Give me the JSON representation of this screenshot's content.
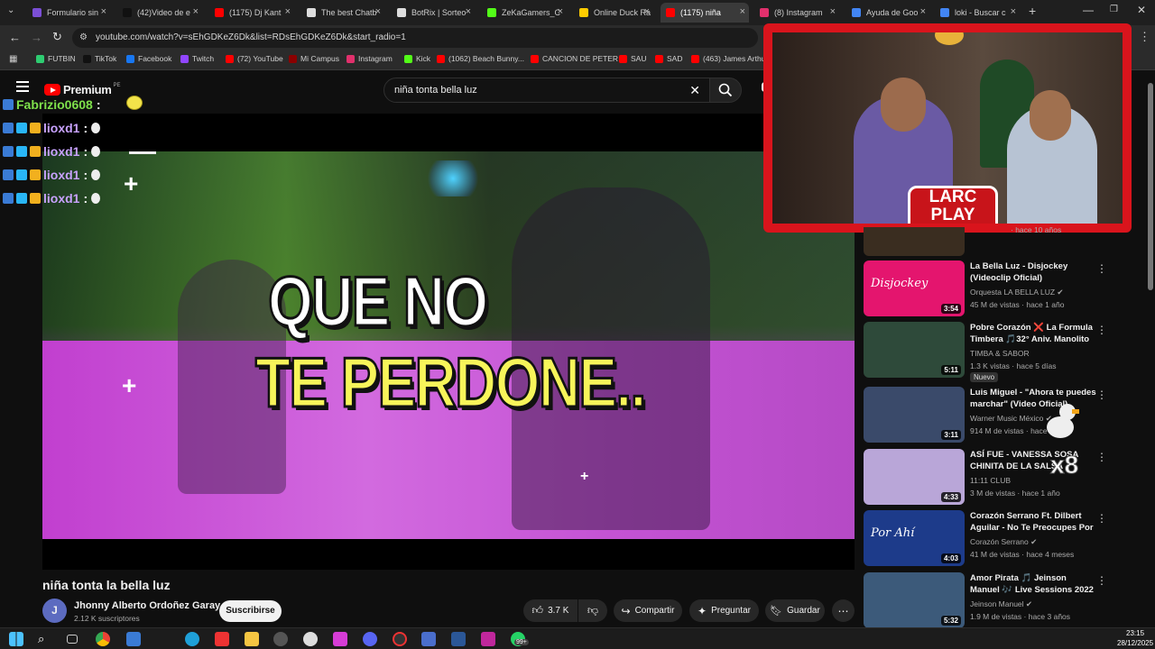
{
  "tabs": [
    {
      "label": "Formulario sin",
      "color": "#7b4fd6"
    },
    {
      "label": "(42)Video de e",
      "color": "#111111"
    },
    {
      "label": "(1175) Dj Kant",
      "color": "#ff0000"
    },
    {
      "label": "The best Chatb",
      "color": "#dddddd"
    },
    {
      "label": "BotRix | Sorteo",
      "color": "#dddddd"
    },
    {
      "label": "ZeKaGamers_C",
      "color": "#53fc18"
    },
    {
      "label": "Online Duck Ra",
      "color": "#ffcc00"
    },
    {
      "label": "(1175) niña",
      "color": "#ff0000"
    },
    {
      "label": "(8) Instagram",
      "color": "#e1306c"
    },
    {
      "label": "Ayuda de Goo",
      "color": "#4285f4"
    },
    {
      "label": "loki - Buscar c",
      "color": "#4285f4"
    }
  ],
  "url": "youtube.com/watch?v=sEhGDKeZ6Dk&list=RDsEhGDKeZ6Dk&start_radio=1",
  "bookmarks": [
    {
      "label": "FUTBIN",
      "color": "#2ecc71"
    },
    {
      "label": "TikTok",
      "color": "#111111"
    },
    {
      "label": "Facebook",
      "color": "#1877f2"
    },
    {
      "label": "Twitch",
      "color": "#9146ff"
    },
    {
      "label": "(72) YouTube",
      "color": "#ff0000"
    },
    {
      "label": "Mi Campus",
      "color": "#8b0000"
    },
    {
      "label": "Instagram",
      "color": "#e1306c"
    },
    {
      "label": "Kick",
      "color": "#53fc18"
    },
    {
      "label": "(1062) Beach Bunny...",
      "color": "#ff0000"
    },
    {
      "label": "CANCION DE PETER",
      "color": "#ff0000"
    },
    {
      "label": "SAU",
      "color": "#ff0000"
    },
    {
      "label": "SAD",
      "color": "#ff0000"
    },
    {
      "label": "(463) James Arthur...",
      "color": "#ff0000"
    }
  ],
  "bookmarks_more": "dores",
  "yt": {
    "logo_text": "Premium",
    "region": "PE",
    "search_value": "niña tonta bella luz"
  },
  "chat": [
    {
      "user": "Fabrizio0608",
      "sep": ":",
      "color": "#7ee04b"
    },
    {
      "user": "lioxd1",
      "sep": ":",
      "color": "#c8a2ff"
    },
    {
      "user": "lioxd1",
      "sep": ":",
      "color": "#c8a2ff"
    },
    {
      "user": "lioxd1",
      "sep": ":",
      "color": "#c8a2ff"
    },
    {
      "user": "lioxd1",
      "sep": ":",
      "color": "#c8a2ff"
    }
  ],
  "lyrics": {
    "line1": "QUE NO",
    "line2": "TE PERDONE.."
  },
  "video": {
    "title": "niña tonta la bella luz",
    "channel": "Jhonny Alberto Ordoñez Garay",
    "avatar_letter": "J",
    "subscribers": "2.12 K suscriptores",
    "subscribe_label": "Subscribe"
  },
  "actions": {
    "likes": "3.7 K",
    "share": "Compartir",
    "ask": "Preguntar",
    "save": "Guardar"
  },
  "subscribe_text": "Suscribirse",
  "webcam": {
    "logo_line1": "LARC",
    "logo_line2": "PLAY"
  },
  "duck_multiplier": "x8",
  "sidebar_partial_meta": "· hace 10 años",
  "recommendations": [
    {
      "title": "La Bella Luz - Disjockey (Videoclip Oficial)",
      "channel": "Orquesta LA BELLA LUZ",
      "verified": true,
      "views": "45 M de vistas · hace 1 año",
      "duration": "3:54",
      "thumb": "#e4156e",
      "thumb_text": "Disjockey",
      "badge": ""
    },
    {
      "title": "Pobre Corazón ❌ La Formula Timbera 🎵32° Aniv. Manolito ...",
      "channel": "TIMBA & SABOR",
      "verified": false,
      "views": "1.3 K vistas · hace 5 días",
      "duration": "5:11",
      "thumb": "#2e4a3a",
      "thumb_text": "",
      "badge": "Nuevo"
    },
    {
      "title": "Luis Miguel - \"Ahora te puedes marchar\" (Video Oficial)",
      "channel": "Warner Music México",
      "verified": true,
      "views": "914 M de vistas · hace 7 años",
      "duration": "3:11",
      "thumb": "#3a4a6a",
      "thumb_text": "",
      "badge": ""
    },
    {
      "title": "ASÍ FUE - VANESSA SOSA CHINITA DE LA SALSA",
      "channel": "11:11 CLUB",
      "verified": false,
      "views": "3 M de vistas · hace 1 año",
      "duration": "4:33",
      "thumb": "#b9a6d8",
      "thumb_text": "",
      "badge": ""
    },
    {
      "title": "Corazón Serrano Ft. Dilbert Aguilar - No Te Preocupes Por ...",
      "channel": "Corazón Serrano",
      "verified": true,
      "views": "41 M de vistas · hace 4 meses",
      "duration": "4:03",
      "thumb": "#1d3b8a",
      "thumb_text": "Por Ahí",
      "badge": ""
    },
    {
      "title": "Amor Pirata 🎵 Jeinson Manuel 🎶 Live Sessions 2022",
      "channel": "Jeinson Manuel",
      "verified": true,
      "views": "1.9 M de vistas · hace 3 años",
      "duration": "5:32",
      "thumb": "#3c5a7a",
      "thumb_text": "",
      "badge": ""
    }
  ],
  "clock": {
    "time": "23:15",
    "date": "28/12/2025"
  },
  "tray_badge": "99+"
}
